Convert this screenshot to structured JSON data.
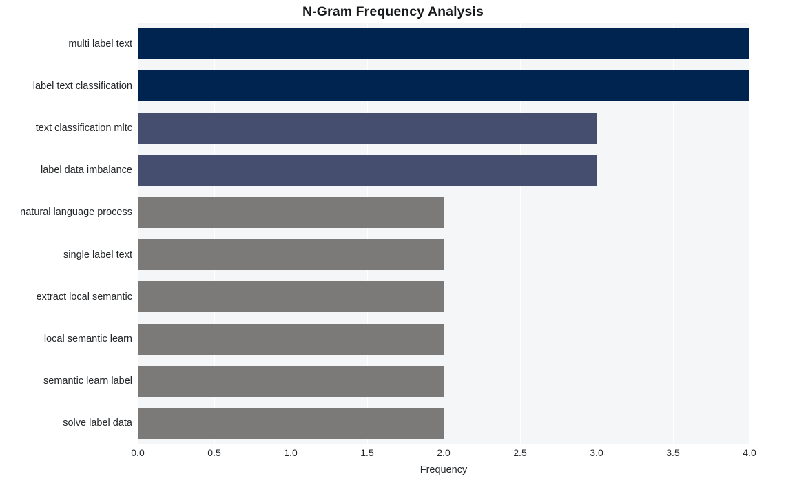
{
  "chart_data": {
    "type": "bar",
    "orientation": "horizontal",
    "title": "N-Gram Frequency Analysis",
    "xlabel": "Frequency",
    "ylabel": "",
    "categories": [
      "multi label text",
      "label text classification",
      "text classification mltc",
      "label data imbalance",
      "natural language process",
      "single label text",
      "extract local semantic",
      "local semantic learn",
      "semantic learn label",
      "solve label data"
    ],
    "values": [
      4,
      4,
      3,
      3,
      2,
      2,
      2,
      2,
      2,
      2
    ],
    "bar_colors": [
      "#002450",
      "#002450",
      "#454e6e",
      "#454e6e",
      "#7b7a78",
      "#7b7a78",
      "#7b7a78",
      "#7b7a78",
      "#7b7a78",
      "#7b7a78"
    ],
    "xlim": [
      0.0,
      4.0
    ],
    "xticks": [
      "0.0",
      "0.5",
      "1.0",
      "1.5",
      "2.0",
      "2.5",
      "3.0",
      "3.5",
      "4.0"
    ],
    "xtick_values": [
      0.0,
      0.5,
      1.0,
      1.5,
      2.0,
      2.5,
      3.0,
      3.5,
      4.0
    ],
    "grid": true,
    "grid_axis": "x",
    "grid_color": "#ffffff",
    "panel_background": "#f5f6f7",
    "figure_background": "#ffffff",
    "legend": null,
    "legend_position": "none"
  }
}
